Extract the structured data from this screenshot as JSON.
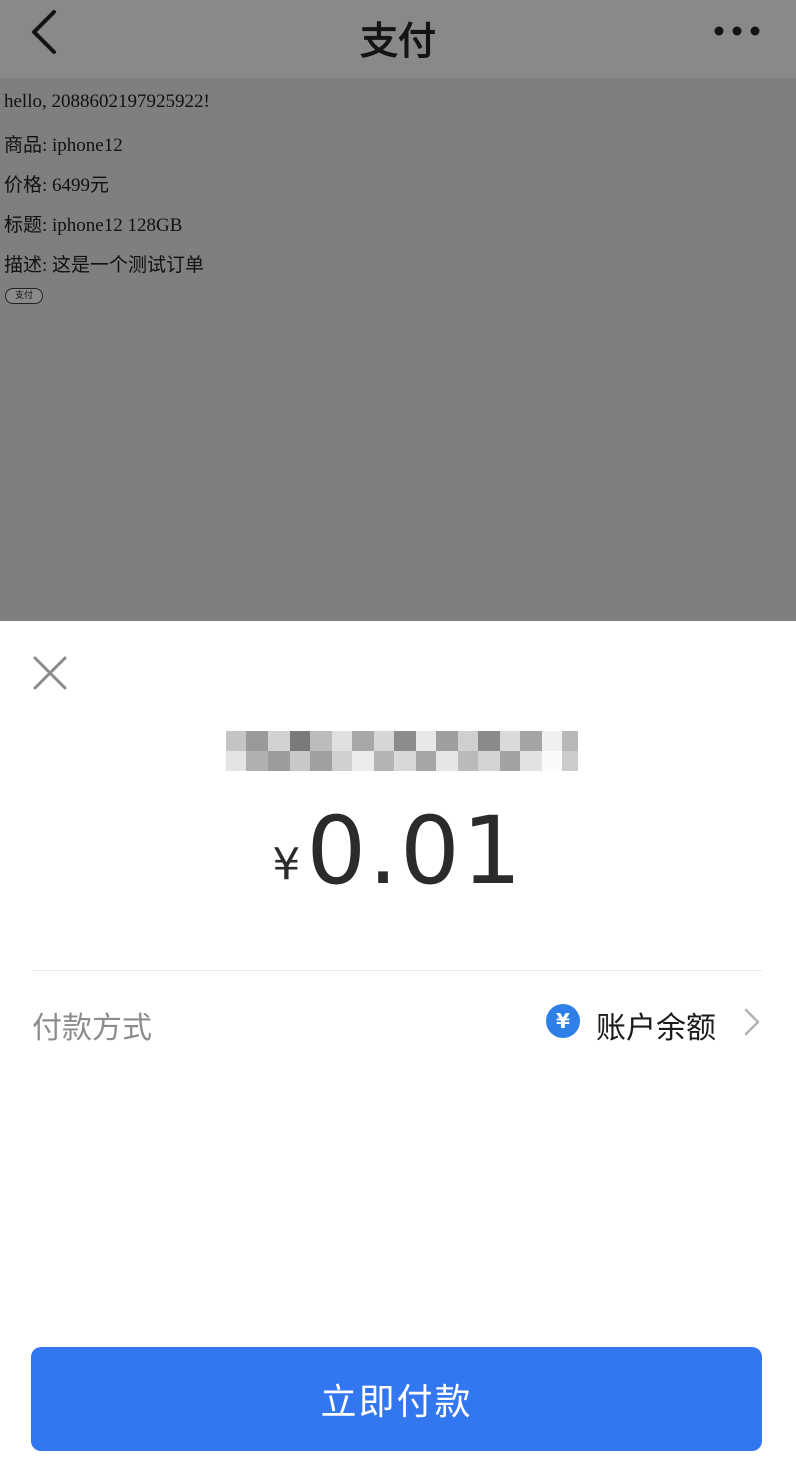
{
  "nav": {
    "title": "支付"
  },
  "page": {
    "greeting": "hello, 2088602197925922!",
    "product": "商品: iphone12",
    "price": "价格: 6499元",
    "subject": "标题: iphone12 128GB",
    "description": "描述: 这是一个测试订单",
    "pay_button": "支付"
  },
  "sheet": {
    "currency_symbol": "¥",
    "amount": "0.01",
    "method_label": "付款方式",
    "method_icon_glyph": "¥",
    "method_value": "账户余额",
    "confirm_button": "立即付款"
  },
  "colors": {
    "accent": "#3377f0",
    "method_icon": "#2f7fe8",
    "overlay": "#7f7f7f"
  }
}
